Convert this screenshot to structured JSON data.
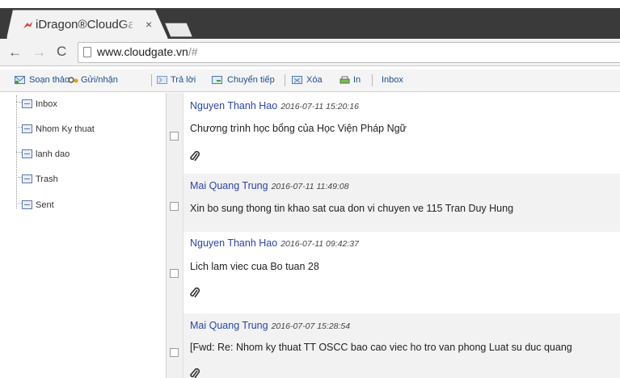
{
  "browser": {
    "tab": {
      "title": "iDragon®CloudGat",
      "close_glyph": "×",
      "favicon": "dragon-favicon",
      "accent": "#d23a2f"
    },
    "nav": {
      "back_glyph": "←",
      "forward_glyph": "→",
      "reload_glyph": "C"
    },
    "address": {
      "url_host": "www.cloudgate.vn",
      "url_rest": "/#"
    }
  },
  "toolbar": {
    "compose_label": "Soạn thảo",
    "send_receive_label": "Gửi/nhận",
    "reply_label": "Trả lời",
    "forward_label": "Chuyển tiếp",
    "delete_label": "Xóa",
    "print_label": "In",
    "folder_label": "Inbox"
  },
  "sidebar": {
    "folders": [
      {
        "label": "Inbox"
      },
      {
        "label": "Nhom Ky thuat"
      },
      {
        "label": "lanh dao"
      },
      {
        "label": "Trash"
      },
      {
        "label": "Sent"
      }
    ]
  },
  "messages": [
    {
      "sender": "Nguyen Thanh Hao",
      "date": "2016-07-11 15:20:16",
      "subject": "Chương trình học bổng của Học Viện Pháp Ngữ",
      "has_attachment": true
    },
    {
      "sender": "Mai Quang Trung",
      "date": "2016-07-11 11:49:08",
      "subject": "Xin bo sung thong tin khao sat cua don vi chuyen ve 115 Tran Duy Hung",
      "has_attachment": false
    },
    {
      "sender": "Nguyen Thanh Hao",
      "date": "2016-07-11 09:42:37",
      "subject": "Lich lam viec cua Bo tuan 28",
      "has_attachment": true
    },
    {
      "sender": "Mai Quang Trung",
      "date": "2016-07-07 15:28:54",
      "subject": "[Fwd: Re: Nhom ky thuat TT OSCC bao cao viec ho tro van phong Luat su duc quang",
      "has_attachment": true
    }
  ],
  "colors": {
    "sender": "#2a46a8",
    "toolbar_text": "#1d4f91",
    "tabstrip": "#3a3a3a"
  }
}
